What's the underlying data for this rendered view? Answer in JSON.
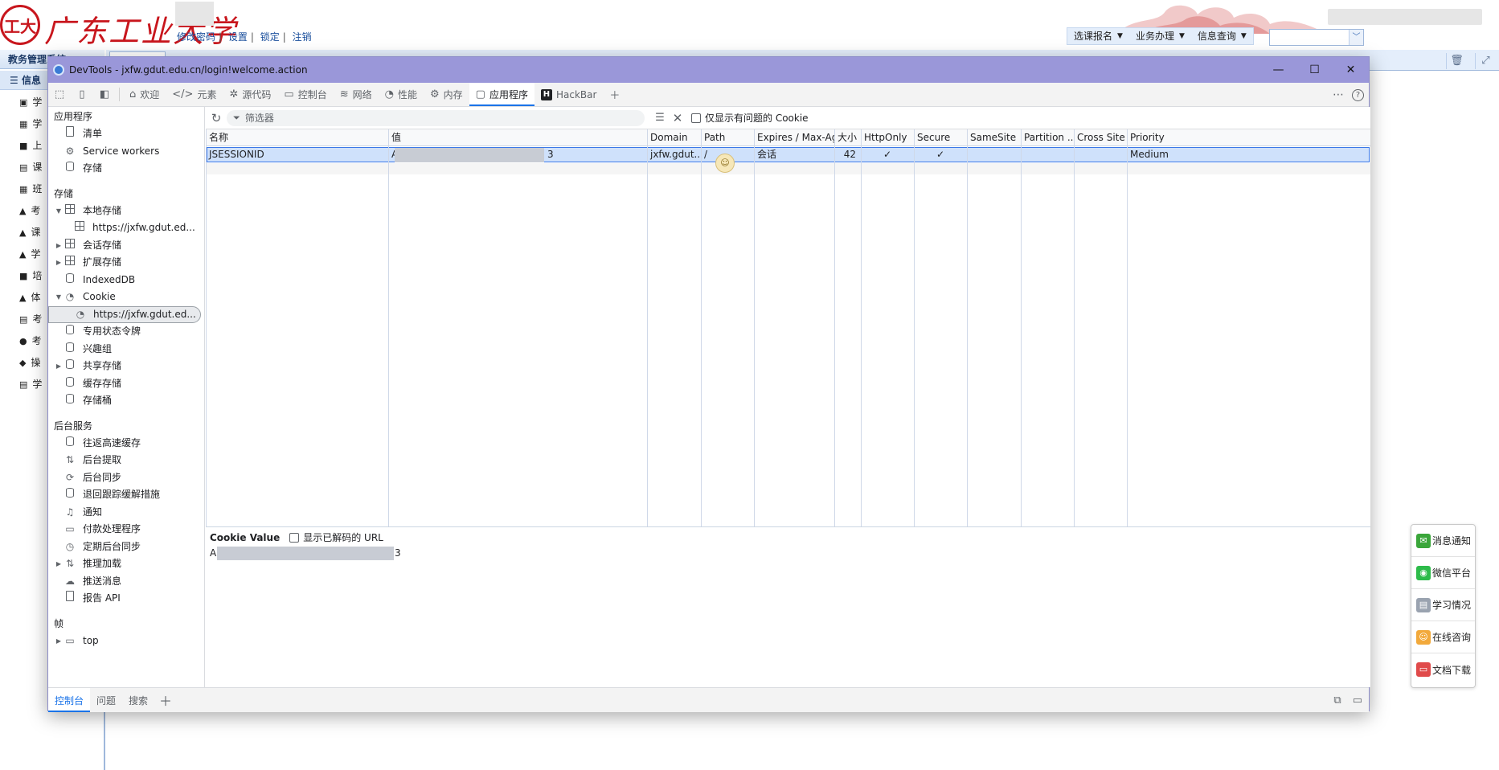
{
  "site": {
    "logo_seal": "工大",
    "logo_text": "广东工业大学",
    "user_links": [
      "修改密码",
      "设置",
      "锁定",
      "注销"
    ],
    "top_menu": [
      "选课报名",
      "业务办理",
      "信息查询"
    ],
    "side_title": "教务管理系统",
    "side_sub": "信息",
    "side_items": [
      {
        "label": "学",
        "icon": "id-card-icon",
        "glyph": "▣"
      },
      {
        "label": "学",
        "icon": "grid-icon",
        "glyph": "▦"
      },
      {
        "label": "上",
        "icon": "book-icon",
        "glyph": "■"
      },
      {
        "label": "课",
        "icon": "calendar-icon",
        "glyph": "▤"
      },
      {
        "label": "班",
        "icon": "table-icon",
        "glyph": "▦"
      },
      {
        "label": "考",
        "icon": "graduation-icon",
        "glyph": "▲"
      },
      {
        "label": "课",
        "icon": "graduation-icon",
        "glyph": "▲"
      },
      {
        "label": "学",
        "icon": "warning-icon",
        "glyph": "▲"
      },
      {
        "label": "培",
        "icon": "book-icon",
        "glyph": "■"
      },
      {
        "label": "体",
        "icon": "graduation-icon",
        "glyph": "▲"
      },
      {
        "label": "考",
        "icon": "calendar-icon",
        "glyph": "▤"
      },
      {
        "label": "考",
        "icon": "user-add-icon",
        "glyph": "●"
      },
      {
        "label": "操",
        "icon": "binoculars-icon",
        "glyph": "◆"
      },
      {
        "label": "学",
        "icon": "document-icon",
        "glyph": "▤"
      }
    ],
    "float_panel": [
      {
        "label": "消息通知",
        "icon": "message-icon",
        "color": "#3aa63a"
      },
      {
        "label": "微信平台",
        "icon": "wechat-icon",
        "color": "#2dbb4a"
      },
      {
        "label": "学习情况",
        "icon": "study-icon",
        "color": "#9aa3b0"
      },
      {
        "label": "在线咨询",
        "icon": "chat-icon",
        "color": "#f2a93b"
      },
      {
        "label": "文档下载",
        "icon": "folder-icon",
        "color": "#e04a4a"
      }
    ]
  },
  "devtools": {
    "title": "DevTools - jxfw.gdut.edu.cn/login!welcome.action",
    "tabs": [
      {
        "label": "欢迎",
        "icon": "home-icon",
        "glyph": "⌂"
      },
      {
        "label": "元素",
        "icon": "code-icon",
        "glyph": "</>"
      },
      {
        "label": "源代码",
        "icon": "bug-icon",
        "glyph": "✲"
      },
      {
        "label": "控制台",
        "icon": "console-icon",
        "glyph": "▭"
      },
      {
        "label": "网络",
        "icon": "wifi-icon",
        "glyph": "≋"
      },
      {
        "label": "性能",
        "icon": "performance-icon",
        "glyph": "◔"
      },
      {
        "label": "内存",
        "icon": "memory-icon",
        "glyph": "⚙"
      },
      {
        "label": "应用程序",
        "icon": "application-icon",
        "glyph": "▢"
      },
      {
        "label": "HackBar",
        "icon": "hackbar-icon",
        "glyph": "H"
      }
    ],
    "active_tab": "应用程序",
    "sidebar": {
      "app_section": "应用程序",
      "app_items": [
        "清单",
        "Service workers",
        "存储"
      ],
      "storage_section": "存储",
      "local_storage": "本地存储",
      "local_storage_child": "https://jxfw.gdut.ed...",
      "session_storage": "会话存储",
      "extension_storage": "扩展存储",
      "indexeddb": "IndexedDB",
      "cookie": "Cookie",
      "cookie_child": "https://jxfw.gdut.ed...",
      "private_state_tokens": "专用状态令牌",
      "interest_groups": "兴趣组",
      "shared_storage": "共享存储",
      "cache_storage": "缓存存储",
      "storage_buckets": "存储桶",
      "bg_section": "后台服务",
      "bg_items": [
        "往返高速缓存",
        "后台提取",
        "后台同步",
        "退回跟踪缓解措施",
        "通知",
        "付款处理程序",
        "定期后台同步",
        "推理加载",
        "推送消息",
        "报告 API"
      ],
      "frames_section": "帧",
      "frames_top": "top"
    },
    "filter": {
      "placeholder": "筛选器",
      "only_issues": "仅显示有问题的 Cookie"
    },
    "table": {
      "columns": [
        "名称",
        "值",
        "Domain",
        "Path",
        "Expires / Max-Age",
        "大小",
        "HttpOnly",
        "Secure",
        "SameSite",
        "Partition ...",
        "Cross Site",
        "Priority"
      ],
      "rows": [
        {
          "name": "JSESSIONID",
          "value_start": "A",
          "value_end": "3",
          "domain": "jxfw.gdut....",
          "path": "/",
          "expires": "会话",
          "size": "42",
          "httponly": "✓",
          "secure": "✓",
          "samesite": "",
          "partition": "",
          "cross_site": "",
          "priority": "Medium"
        }
      ]
    },
    "value_pane": {
      "title": "Cookie Value",
      "show_decoded": "显示已解码的 URL",
      "value_start": "A",
      "value_end": "3"
    },
    "drawer": {
      "tabs": [
        "控制台",
        "问题",
        "搜索"
      ]
    }
  }
}
